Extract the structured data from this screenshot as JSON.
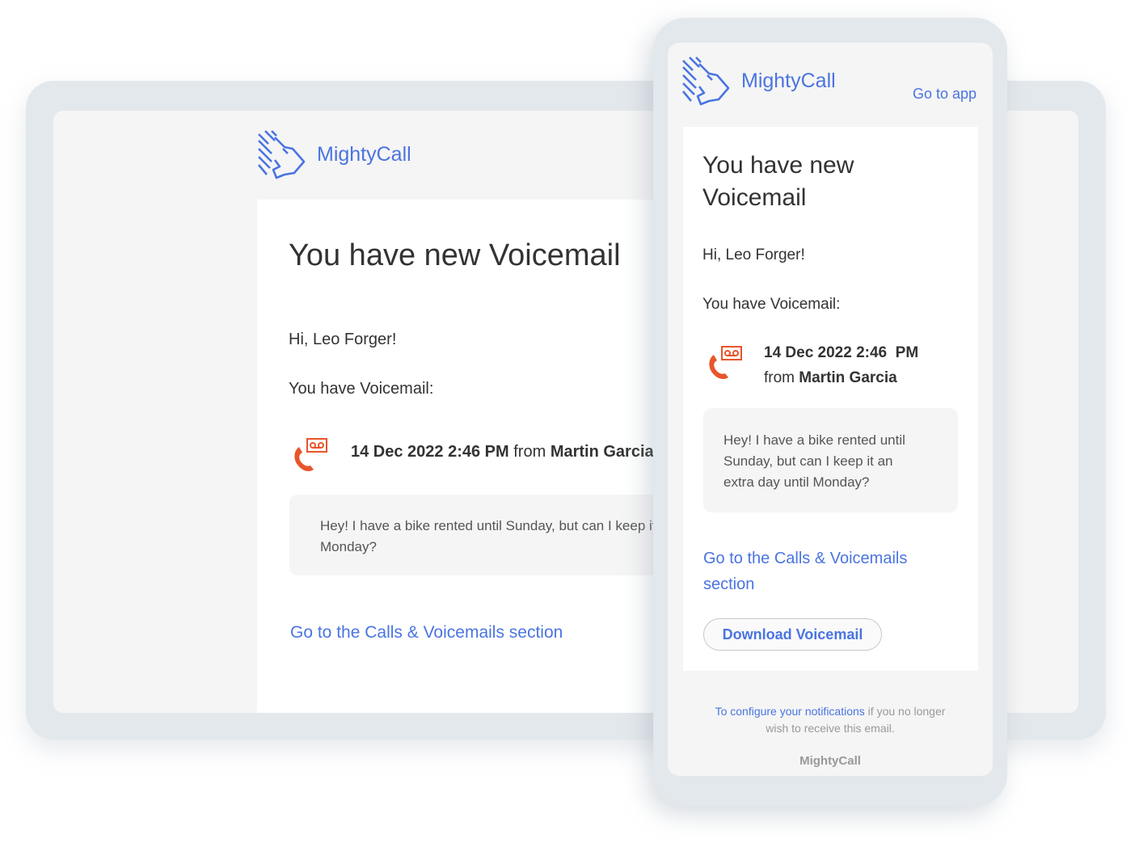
{
  "brand": {
    "name": "MightyCall",
    "accent": "#4a74e0",
    "icon_color": "#e8552a"
  },
  "desktop": {
    "title": "You have new Voicemail",
    "greeting": "Hi, Leo Forger!",
    "intro": "You have Voicemail:",
    "datetime": "14 Dec 2022 2:46 PM",
    "from_label": "from",
    "caller": "Martin Garcia",
    "message": "Hey! I have a bike rented until Sunday, but can I keep it an extra day until Monday?",
    "message_line1": "Hey! I have a bike rented until Sunday, but can I keep it an extra day until",
    "message_line2": "Monday?",
    "link": "Go to the Calls & Voicemails section"
  },
  "mobile": {
    "go_to_app": "Go to app",
    "title_line1": "You have new",
    "title_line2": "Voicemail",
    "greeting": "Hi, Leo Forger!",
    "intro": "You have Voicemail:",
    "datetime": "14 Dec 2022 2:46  PM",
    "from_label": "from",
    "caller": "Martin Garcia",
    "message_lines": [
      "Hey! I have a bike rented until",
      "Sunday, but can I keep it an",
      "extra day until Monday?"
    ],
    "link_line1": "Go to the Calls & Voicemails",
    "link_line2": "section",
    "download_button": "Download Voicemail",
    "footer_link": "To configure your notifications",
    "footer_text1": " if you no longer",
    "footer_text2": "wish to receive this email.",
    "footer_brand": "MightyCall"
  }
}
